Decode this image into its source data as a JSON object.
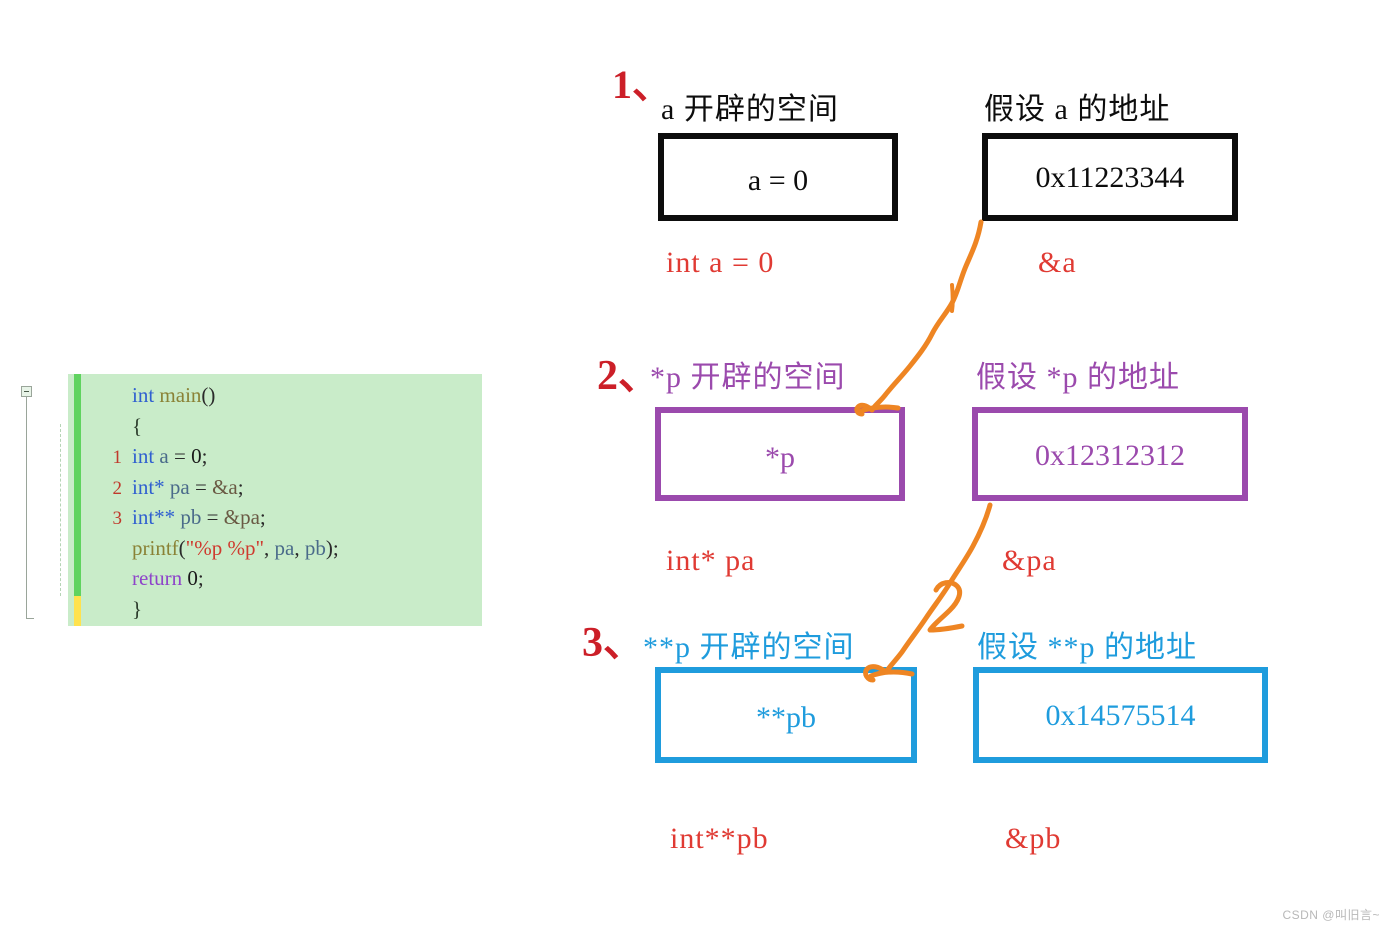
{
  "code_block": {
    "language": "c",
    "lines": [
      {
        "number": "",
        "tokens": [
          {
            "t": "int",
            "c": "kw"
          },
          {
            "t": " ",
            "c": "punc"
          },
          {
            "t": "main",
            "c": "fn"
          },
          {
            "t": "()",
            "c": "punc"
          }
        ]
      },
      {
        "number": "",
        "tokens": [
          {
            "t": "{",
            "c": "brace"
          }
        ]
      },
      {
        "number": "1",
        "tokens": [
          {
            "t": "int",
            "c": "kw"
          },
          {
            "t": " ",
            "c": "punc"
          },
          {
            "t": "a",
            "c": "ident"
          },
          {
            "t": " = ",
            "c": "punc"
          },
          {
            "t": "0",
            "c": "num"
          },
          {
            "t": ";",
            "c": "punc"
          }
        ]
      },
      {
        "number": "2",
        "tokens": [
          {
            "t": "int",
            "c": "kw"
          },
          {
            "t": "*",
            "c": "star"
          },
          {
            "t": " ",
            "c": "punc"
          },
          {
            "t": "pa",
            "c": "ident"
          },
          {
            "t": " = ",
            "c": "punc"
          },
          {
            "t": "&a",
            "c": "amp"
          },
          {
            "t": ";",
            "c": "punc"
          }
        ]
      },
      {
        "number": "3",
        "tokens": [
          {
            "t": "int",
            "c": "kw"
          },
          {
            "t": "**",
            "c": "star"
          },
          {
            "t": " ",
            "c": "punc"
          },
          {
            "t": "pb",
            "c": "ident"
          },
          {
            "t": " = ",
            "c": "punc"
          },
          {
            "t": "&pa",
            "c": "amp"
          },
          {
            "t": ";",
            "c": "punc"
          }
        ]
      },
      {
        "number": "",
        "tokens": [
          {
            "t": "printf",
            "c": "fn"
          },
          {
            "t": "(",
            "c": "punc"
          },
          {
            "t": "\"%p %p\"",
            "c": "str"
          },
          {
            "t": ", ",
            "c": "punc"
          },
          {
            "t": "pa",
            "c": "ident"
          },
          {
            "t": ", ",
            "c": "punc"
          },
          {
            "t": "pb",
            "c": "ident"
          },
          {
            "t": ");",
            "c": "punc"
          }
        ]
      },
      {
        "number": "",
        "tokens": [
          {
            "t": "return",
            "c": "kw2"
          },
          {
            "t": " ",
            "c": "punc"
          },
          {
            "t": "0",
            "c": "num"
          },
          {
            "t": ";",
            "c": "punc"
          }
        ]
      },
      {
        "number": "",
        "tokens": [
          {
            "t": "}",
            "c": "brace"
          }
        ]
      }
    ]
  },
  "sections": [
    {
      "marker": "1、",
      "marker_color": "#cc1f28",
      "color": "#0d0d0d",
      "left_header": "a 开辟的空间",
      "right_header": "假设 a 的地址",
      "left_value": "a = 0",
      "right_value": "0x11223344",
      "left_caption": "int a = 0",
      "right_caption": "&a"
    },
    {
      "marker": "2、",
      "marker_color": "#cc1f28",
      "color": "#9b4aad",
      "left_header": "*p 开辟的空间",
      "right_header": "假设 *p 的地址",
      "left_value": "*p",
      "right_value": "0x12312312",
      "left_caption": "int* pa",
      "right_caption": "&pa"
    },
    {
      "marker": "3、",
      "marker_color": "#cc1f28",
      "color": "#1f9cdd",
      "left_header": "**p 开辟的空间",
      "right_header": "假设 **p 的地址",
      "left_value": "**pb",
      "right_value": "0x14575514",
      "left_caption": "int**pb",
      "right_caption": "&pb"
    }
  ],
  "annotations": {
    "arrow_color": "#ee8523",
    "arrow_1_label": "",
    "arrow_2_label": "2",
    "caption_color": "#e03a33"
  },
  "watermark": "CSDN @叫旧言~"
}
